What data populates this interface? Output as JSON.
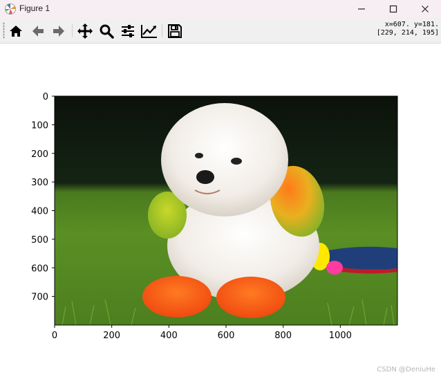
{
  "window": {
    "title": "Figure 1",
    "minimize_icon": "minimize-icon",
    "maximize_icon": "maximize-icon",
    "close_icon": "close-icon"
  },
  "toolbar": {
    "buttons": [
      "home-icon",
      "back-arrow-icon",
      "forward-arrow-icon",
      "pan-icon",
      "zoom-icon",
      "subplots-icon",
      "edit-axis-icon",
      "save-icon"
    ],
    "coords_line1": "x=607. y=181.",
    "coords_line2": "[229, 214, 195]"
  },
  "plot": {
    "image_subject": "white poodle with rainbow-dyed ears and feet lying on grass",
    "x_ticks": [
      "0",
      "200",
      "400",
      "600",
      "800",
      "1000"
    ],
    "y_ticks": [
      "0",
      "100",
      "200",
      "300",
      "400",
      "500",
      "600",
      "700"
    ],
    "x_tick_values": [
      0,
      200,
      400,
      600,
      800,
      1000
    ],
    "y_tick_values": [
      0,
      100,
      200,
      300,
      400,
      500,
      600,
      700
    ],
    "xlim": [
      0,
      1200
    ],
    "ylim": [
      800,
      0
    ]
  },
  "watermark": "CSDN @DeniuHe"
}
